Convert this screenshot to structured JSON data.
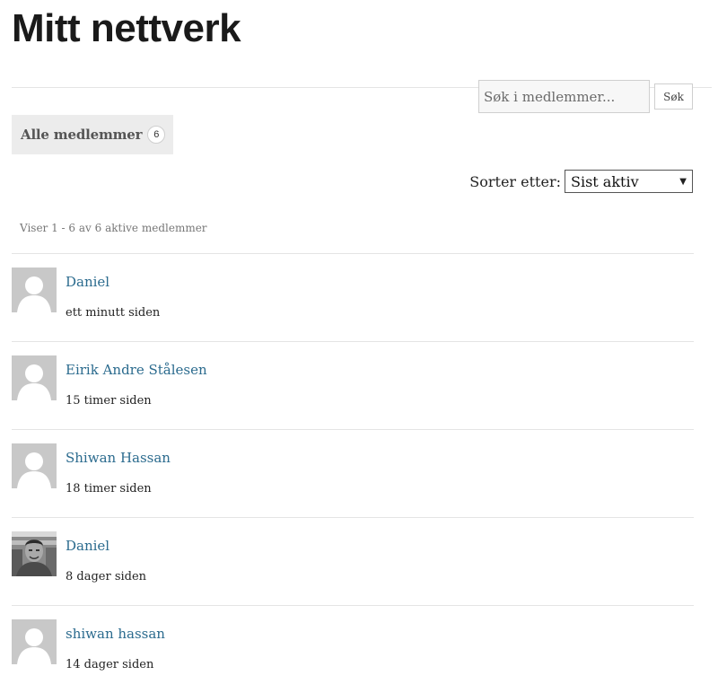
{
  "header": {
    "title": "Mitt nettverk"
  },
  "search": {
    "placeholder": "Søk i medlemmer...",
    "button_label": "Søk"
  },
  "filter": {
    "tab_label": "Alle medlemmer",
    "count": "6"
  },
  "sort": {
    "label": "Sorter etter:",
    "selected": "Sist aktiv"
  },
  "pagination": {
    "text": "Viser 1 - 6 av 6 aktive medlemmer"
  },
  "members": [
    {
      "name": "Daniel",
      "last_active": "ett minutt siden",
      "avatar": "default-avatar"
    },
    {
      "name": "Eirik Andre Stålesen",
      "last_active": "15 timer siden",
      "avatar": "default-avatar"
    },
    {
      "name": "Shiwan Hassan",
      "last_active": "18 timer siden",
      "avatar": "default-avatar"
    },
    {
      "name": "Daniel",
      "last_active": "8 dager siden",
      "avatar": "photo-avatar"
    },
    {
      "name": "shiwan hassan",
      "last_active": "14 dager siden",
      "avatar": "default-avatar"
    }
  ],
  "colors": {
    "link": "#2b6b8e",
    "avatar_bg": "#c8c8c8",
    "tab_bg": "#ececec"
  }
}
